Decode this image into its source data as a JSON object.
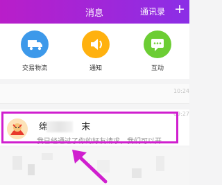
{
  "header": {
    "title": "消息",
    "contacts_label": "通讯录",
    "add_label": "+"
  },
  "quick_items": [
    {
      "label": "交易物流",
      "icon": "truck-icon",
      "color": "#3d99ea"
    },
    {
      "label": "通知",
      "icon": "speaker-icon",
      "color": "#ffb10f"
    },
    {
      "label": "互动",
      "icon": "chat-icon",
      "color": "#6ccd34"
    }
  ],
  "conversations": [
    {
      "time": "10:24"
    },
    {
      "name_visible": "绵",
      "name_suffix": "末",
      "message": "我已经通过了你的好友请求，我们可以开",
      "time": "09:27",
      "avatar_icon": "cartoon-mascot-avatar"
    }
  ],
  "colors": {
    "header_start": "#b91ec9",
    "header_end": "#8b2ee6",
    "highlight": "#d01fcf"
  }
}
